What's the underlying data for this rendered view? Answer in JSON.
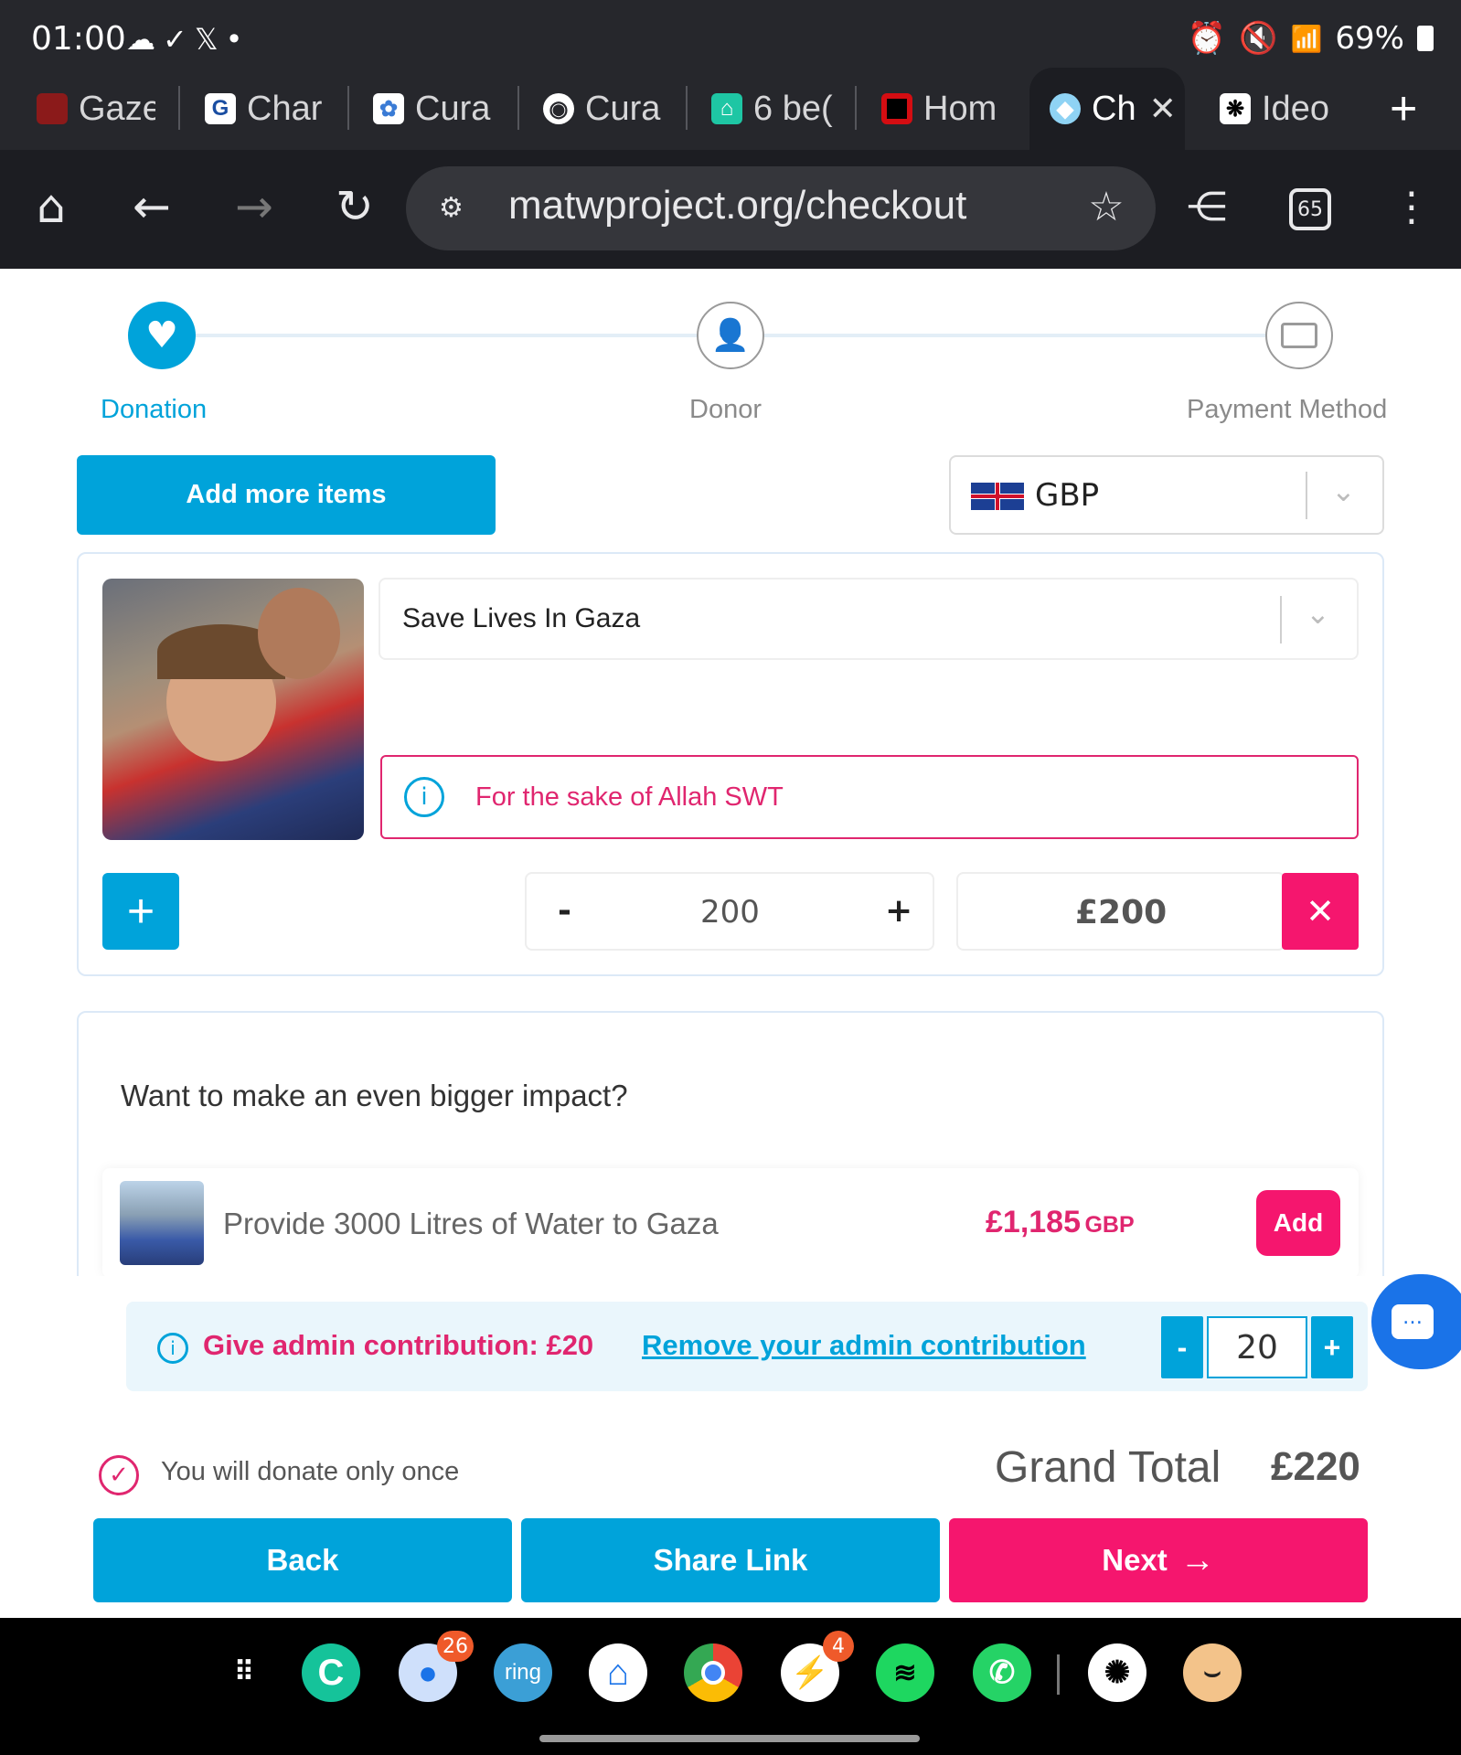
{
  "status_bar": {
    "time": "01:00",
    "battery": "69%"
  },
  "tabs": [
    {
      "label": "Gaze",
      "favicon": "red-square-icon"
    },
    {
      "label": "Char",
      "favicon": "G"
    },
    {
      "label": "Cura",
      "favicon": "flower-icon"
    },
    {
      "label": "Cura",
      "favicon": "globe-icon"
    },
    {
      "label": "6 be(",
      "favicon": "house-icon"
    },
    {
      "label": "Hom",
      "favicon": "red-square-icon"
    },
    {
      "label": "Ch",
      "favicon": "blue-globe-icon"
    },
    {
      "label": "Ideo",
      "favicon": "brain-icon"
    }
  ],
  "toolbar": {
    "url": "matwproject.org/checkout",
    "tab_count": "65"
  },
  "stepper": {
    "steps": [
      "Donation",
      "Donor",
      "Payment Method"
    ],
    "active": 0
  },
  "actions": {
    "add_more_items": "Add more items"
  },
  "currency": {
    "code": "GBP"
  },
  "donation_item": {
    "name": "Save Lives In Gaza",
    "note": "For the sake of Allah SWT",
    "quantity": "200",
    "amount": "£200",
    "minus": "-",
    "plus": "+"
  },
  "upsell": {
    "heading": "Want to make an even bigger impact?",
    "title": "Provide 3000 Litres of Water to Gaza",
    "price": "£1,185",
    "currency": "GBP",
    "add_label": "Add"
  },
  "admin": {
    "text": "Give admin contribution: £20",
    "remove_link": "Remove your admin contribution",
    "value": "20",
    "minus": "-",
    "plus": "+"
  },
  "summary": {
    "once_text": "You will donate only once",
    "grand_total_label": "Grand Total",
    "grand_total_value": "£220"
  },
  "footer_buttons": {
    "back": "Back",
    "share": "Share Link",
    "next": "Next"
  },
  "dock": {
    "apps": [
      "apps-grid-icon",
      "grammarly-icon",
      "messages-icon",
      "ring-icon",
      "smart-home-icon",
      "chrome-icon",
      "messenger-icon",
      "spotify-icon",
      "whatsapp-icon",
      "chatgpt-icon",
      "amazon-icon"
    ],
    "badges": {
      "messages": "26",
      "messenger": "4"
    },
    "ring_label": "ring"
  },
  "colors": {
    "blue": "#00a3da",
    "pink": "#f5166e",
    "dark": "#1c1d22"
  }
}
